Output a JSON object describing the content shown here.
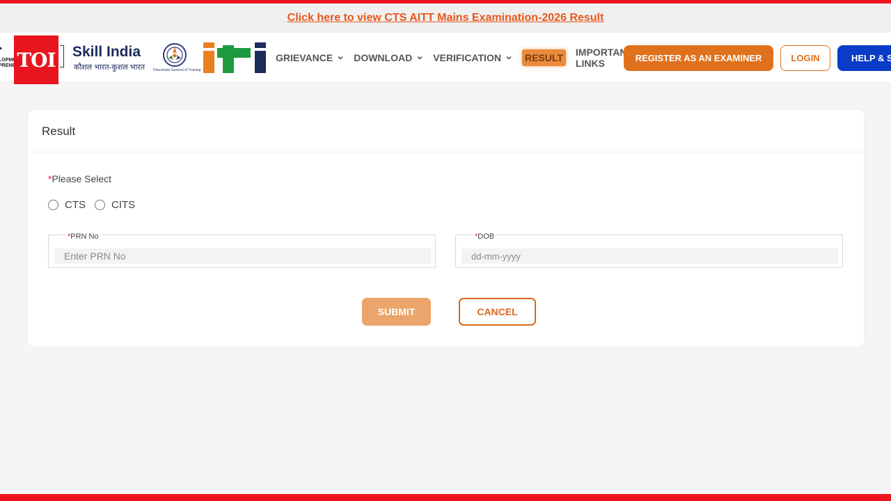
{
  "announcement": {
    "link_text": "Click here to view CTS AITT Mains Examination-2026 Result"
  },
  "header": {
    "partial_logo_text": [
      "LOPME",
      "PRENE"
    ],
    "toi_badge": "TOI",
    "skill_india": {
      "title": "Skill India",
      "subtitle": "कौशल भारत-कुशल भारत"
    },
    "dgt_caption": "Directorate General of Training",
    "nav": [
      {
        "label": "GRIEVANCE",
        "has_dropdown": true
      },
      {
        "label": "DOWNLOAD",
        "has_dropdown": true
      },
      {
        "label": "VERIFICATION",
        "has_dropdown": true
      },
      {
        "label": "RESULT",
        "has_dropdown": false,
        "active": true
      },
      {
        "label_line1": "IMPORTANT",
        "label_line2": "LINKS",
        "has_dropdown": true
      }
    ],
    "register_button": "REGISTER AS AN EXAMINER",
    "login_button": "LOGIN",
    "help_button": "HELP & SU"
  },
  "card": {
    "title": "Result",
    "select_label": "Please Select",
    "required_mark": "*",
    "radio_options": [
      "CTS",
      "CITS"
    ],
    "prn": {
      "label": "PRN No",
      "placeholder": "Enter PRN No"
    },
    "dob": {
      "label": "DOB",
      "placeholder": "dd-mm-yyyy"
    },
    "submit_button": "SUBMIT",
    "cancel_button": "CANCEL"
  },
  "colors": {
    "brand_orange": "#e0711c",
    "help_blue": "#0a3cc7",
    "toi_red": "#e8141e",
    "submit_disabled": "#eba46a"
  }
}
